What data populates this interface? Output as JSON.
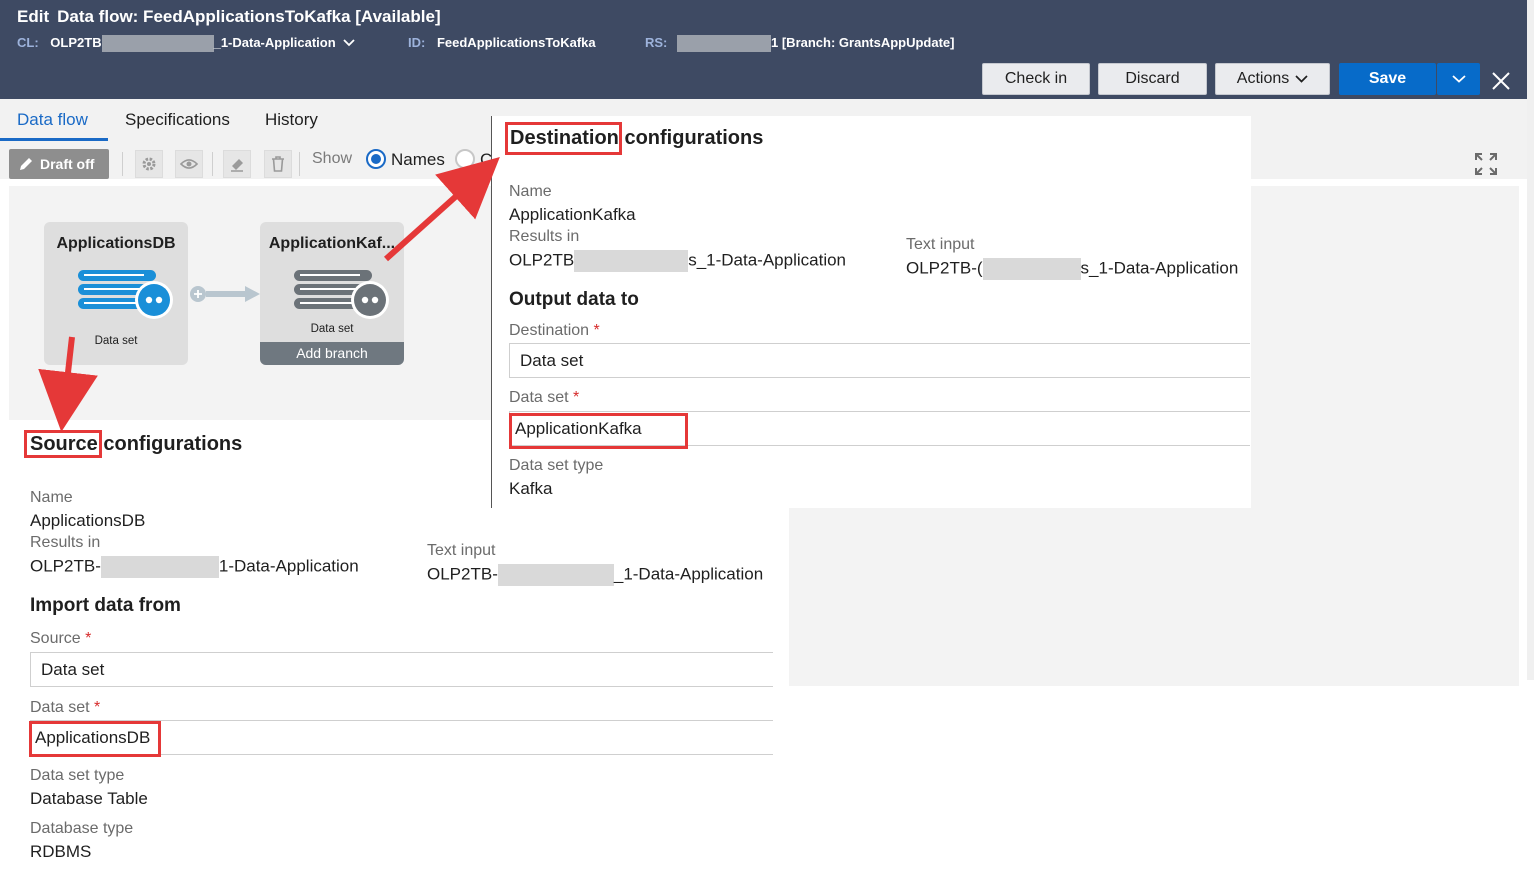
{
  "header": {
    "edit_label": "Edit",
    "title": "Data flow: FeedApplicationsToKafka [Available]",
    "cl_key": "CL:",
    "cl_value_start": "OLP2TB",
    "cl_value_end": "_1-Data-Application",
    "id_key": "ID:",
    "id_value": "FeedApplicationsToKafka",
    "rs_key": "RS:",
    "rs_value_end": "1 [Branch: GrantsAppUpdate]",
    "checkin_label": "Check in",
    "discard_label": "Discard",
    "actions_label": "Actions",
    "save_label": "Save"
  },
  "tabs": [
    {
      "label": "Data flow",
      "active": true
    },
    {
      "label": "Specifications",
      "active": false
    },
    {
      "label": "History",
      "active": false
    }
  ],
  "toolbar": {
    "draft_label": "Draft off",
    "show_label": "Show",
    "names_label": "Names",
    "other_label_visible": "C"
  },
  "nodes": {
    "source": {
      "title": "ApplicationsDB",
      "subtitle": "Data set"
    },
    "dest": {
      "title": "ApplicationKaf...",
      "subtitle": "Data set",
      "add_branch": "Add branch"
    }
  },
  "source_config": {
    "title_highlight": "Source",
    "title_rest": " configurations",
    "name_label": "Name",
    "name_value": "ApplicationsDB",
    "results_label": "Results in",
    "results_value_start": "OLP2TB-",
    "results_value_end": "1-Data-Application",
    "text_input_label": "Text input",
    "text_input_value_start": "OLP2TB-",
    "text_input_value_end": "_1-Data-Application",
    "import_title": "Import data from",
    "source_label": "Source",
    "source_value": "Data set",
    "dataset_label": "Data set",
    "dataset_value": "ApplicationsDB",
    "dataset_type_label": "Data set type",
    "dataset_type_value": "Database Table",
    "db_type_label": "Database type",
    "db_type_value": "RDBMS"
  },
  "dest_config": {
    "title_highlight": "Destination",
    "title_rest": " configurations",
    "name_label": "Name",
    "name_value": "ApplicationKafka",
    "results_label": "Results in",
    "results_value_start": "OLP2TB",
    "results_value_end": "s_1-Data-Application",
    "text_input_label": "Text input",
    "text_input_value_start": "OLP2TB-(",
    "text_input_value_end": "s_1-Data-Application",
    "output_title": "Output data to",
    "destination_label": "Destination",
    "destination_value": "Data set",
    "dataset_label": "Data set",
    "dataset_value": "ApplicationKafka",
    "dataset_type_label": "Data set type",
    "dataset_type_value": "Kafka"
  },
  "colors": {
    "header_bg": "#3e4a63",
    "accent_blue": "#076bc9",
    "highlight_red": "#e53838"
  }
}
